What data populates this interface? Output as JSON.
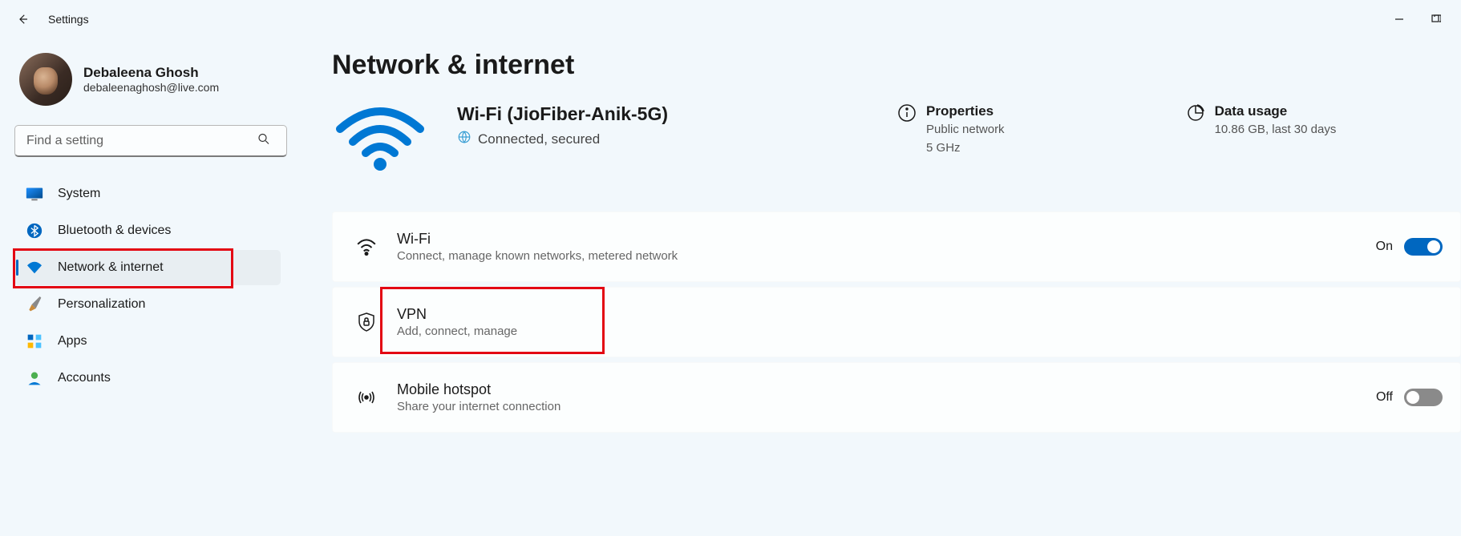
{
  "window": {
    "title": "Settings"
  },
  "profile": {
    "name": "Debaleena Ghosh",
    "email": "debaleenaghosh@live.com"
  },
  "search": {
    "placeholder": "Find a setting"
  },
  "sidebar": {
    "items": [
      {
        "label": "System",
        "icon": "monitor",
        "active": false
      },
      {
        "label": "Bluetooth & devices",
        "icon": "bluetooth",
        "active": false
      },
      {
        "label": "Network & internet",
        "icon": "wifi",
        "active": true
      },
      {
        "label": "Personalization",
        "icon": "brush",
        "active": false
      },
      {
        "label": "Apps",
        "icon": "apps",
        "active": false
      },
      {
        "label": "Accounts",
        "icon": "person",
        "active": false
      }
    ]
  },
  "page": {
    "title": "Network & internet"
  },
  "connection": {
    "title": "Wi-Fi (JioFiber-Anik-5G)",
    "status": "Connected, secured"
  },
  "properties": {
    "title": "Properties",
    "line1": "Public network",
    "line2": "5 GHz"
  },
  "data_usage": {
    "title": "Data usage",
    "line1": "10.86 GB, last 30 days"
  },
  "cards": {
    "wifi": {
      "title": "Wi-Fi",
      "subtitle": "Connect, manage known networks, metered network",
      "state_label": "On",
      "state_on": true
    },
    "vpn": {
      "title": "VPN",
      "subtitle": "Add, connect, manage"
    },
    "hotspot": {
      "title": "Mobile hotspot",
      "subtitle": "Share your internet connection",
      "state_label": "Off",
      "state_on": false
    }
  },
  "highlight": {
    "sidebar_item_index": 2,
    "card": "vpn"
  }
}
